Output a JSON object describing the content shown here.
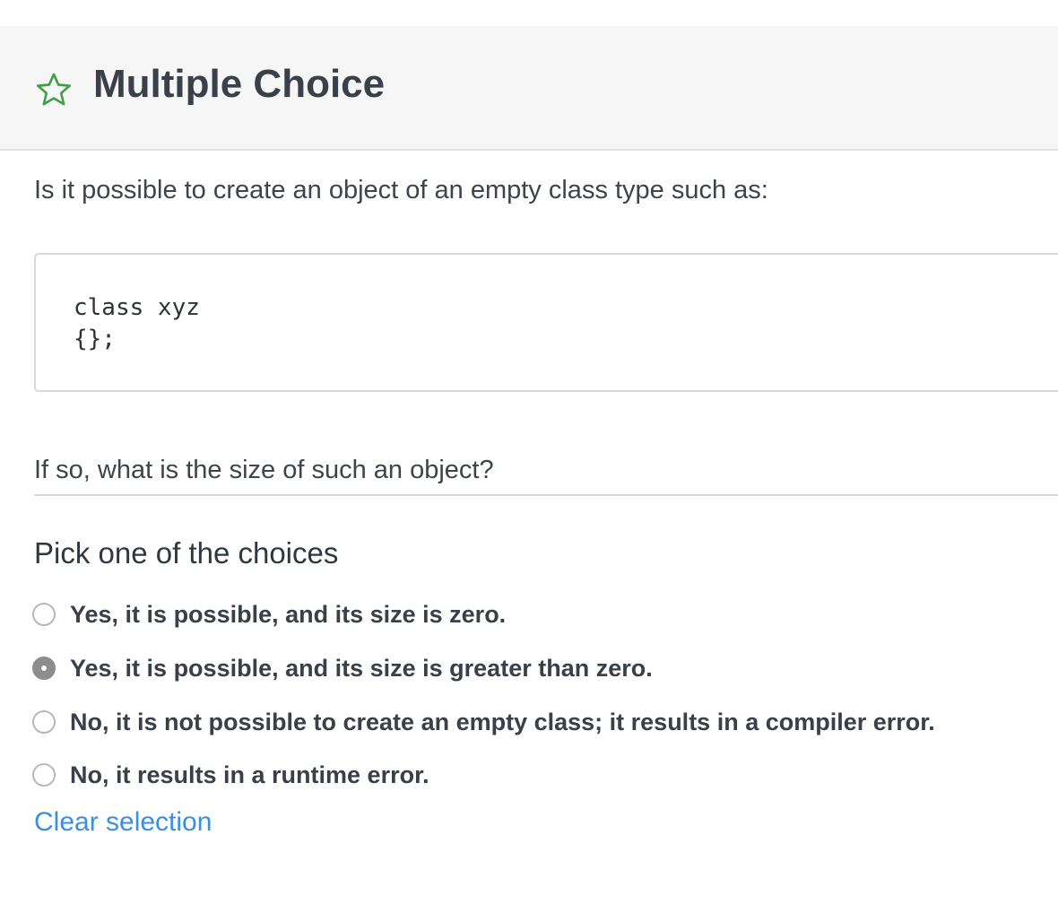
{
  "header": {
    "icon": "star-outline-icon",
    "icon_color": "#43a047",
    "title": "Multiple Choice"
  },
  "question": {
    "text": "Is it possible to create an object of an empty class type such as:",
    "code_lines": [
      "class xyz",
      "{};"
    ],
    "followup": "If so, what is the size of such an object?"
  },
  "choices": {
    "heading": "Pick one of the choices",
    "options": [
      {
        "label": "Yes, it is possible, and its size is zero.",
        "selected": false
      },
      {
        "label": "Yes, it is possible, and its size is greater than zero.",
        "selected": true
      },
      {
        "label": "No, it is not possible to create an empty class; it results in a compiler error.",
        "selected": false
      },
      {
        "label": "No, it results in a runtime error.",
        "selected": false
      }
    ],
    "clear_label": "Clear selection",
    "link_color": "#3b8ee0"
  }
}
